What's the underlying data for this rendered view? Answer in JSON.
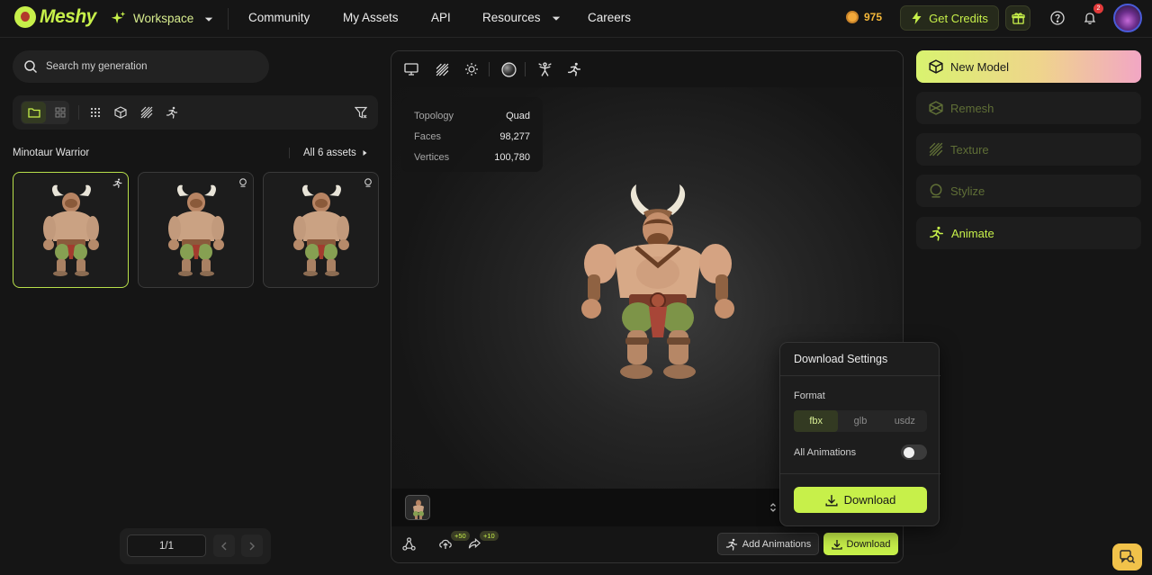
{
  "nav": {
    "brand": "Meshy",
    "workspace": "Workspace",
    "community": "Community",
    "my_assets": "My Assets",
    "api": "API",
    "resources": "Resources",
    "careers": "Careers",
    "credits": "975",
    "get_credits": "Get Credits",
    "notification_count": "2"
  },
  "left": {
    "search_placeholder": "Search my generation",
    "group_title": "Minotaur Warrior",
    "all_assets": "All 6 assets",
    "pager": "1/1"
  },
  "viewer": {
    "stats": [
      {
        "label": "Topology",
        "value": "Quad"
      },
      {
        "label": "Faces",
        "value": "98,277"
      },
      {
        "label": "Vertices",
        "value": "100,780"
      }
    ],
    "upload_badge": "+50",
    "share_badge": "+10",
    "add_animations": "Add Animations",
    "download": "Download"
  },
  "download_settings": {
    "title": "Download Settings",
    "format_label": "Format",
    "formats": [
      "fbx",
      "glb",
      "usdz"
    ],
    "selected_format": "fbx",
    "all_animations_label": "All Animations",
    "all_animations_enabled": false,
    "download_button": "Download"
  },
  "right": {
    "new_model": "New Model",
    "remesh": "Remesh",
    "texture": "Texture",
    "stylize": "Stylize",
    "animate": "Animate"
  },
  "colors": {
    "accent": "#c7f04a",
    "background": "#151515",
    "coin": "#f2a83a"
  }
}
